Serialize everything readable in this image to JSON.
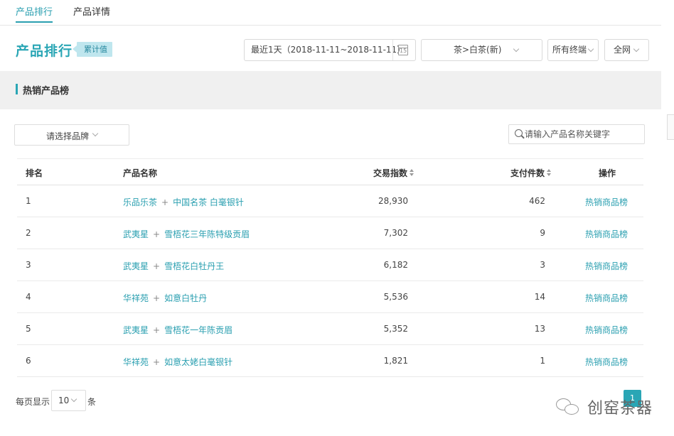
{
  "tabs": [
    {
      "label": "产品排行",
      "active": true
    },
    {
      "label": "产品详情",
      "active": false
    }
  ],
  "header": {
    "title": "产品排行",
    "badge": "累计值",
    "date_range": "最近1天（2018-11-11~2018-11-11）",
    "category": "茶>白茶(新)",
    "terminal": "所有终端",
    "channel": "全网"
  },
  "section": {
    "title": "热销产品榜"
  },
  "filters": {
    "brand_placeholder": "请选择品牌",
    "search_placeholder": "请输入产品名称关键字"
  },
  "table": {
    "columns": {
      "rank": "排名",
      "name": "产品名称",
      "trade_index": "交易指数",
      "paid_items": "支付件数",
      "action": "操作"
    },
    "rows": [
      {
        "rank": "1",
        "brand": "乐品乐茶",
        "product": "中国名茶 白毫银针",
        "trade_index": "28,930",
        "paid_items": "462",
        "action": "热销商品榜"
      },
      {
        "rank": "2",
        "brand": "武夷星",
        "product": "雪梧花三年陈特级贡眉",
        "trade_index": "7,302",
        "paid_items": "9",
        "action": "热销商品榜"
      },
      {
        "rank": "3",
        "brand": "武夷星",
        "product": "雪梧花白牡丹王",
        "trade_index": "6,182",
        "paid_items": "3",
        "action": "热销商品榜"
      },
      {
        "rank": "4",
        "brand": "华祥苑",
        "product": "如意白牡丹",
        "trade_index": "5,536",
        "paid_items": "14",
        "action": "热销商品榜"
      },
      {
        "rank": "5",
        "brand": "武夷星",
        "product": "雪梧花一年陈贡眉",
        "trade_index": "5,352",
        "paid_items": "13",
        "action": "热销商品榜"
      },
      {
        "rank": "6",
        "brand": "华祥苑",
        "product": "如意太姥白毫银针",
        "trade_index": "1,821",
        "paid_items": "1",
        "action": "热销商品榜"
      }
    ]
  },
  "pagination": {
    "per_page_label": "每页显示",
    "per_page_value": "10",
    "per_page_unit": "条",
    "current_page": "1"
  },
  "watermark": {
    "text": "创窑茶器"
  },
  "colors": {
    "accent": "#2aa6b5",
    "link": "#2a9fb0",
    "badge_bg": "#bfe6ee",
    "band_bg": "#f0f0f0"
  }
}
